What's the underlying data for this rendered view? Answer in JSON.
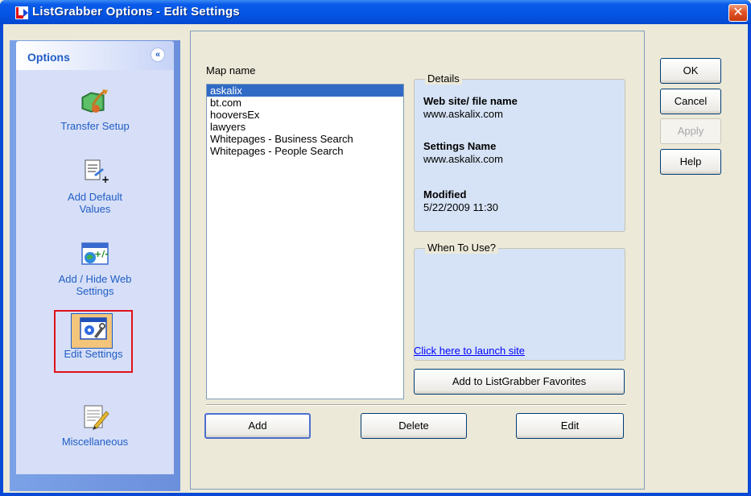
{
  "window": {
    "title": "ListGrabber Options - Edit Settings",
    "close_glyph": "✕"
  },
  "sidebar": {
    "header": "Options",
    "collapse_glyph": "«",
    "items": [
      {
        "label": "Transfer Setup",
        "icon": "transfer-setup-icon"
      },
      {
        "label": "Add Default Values",
        "icon": "add-default-values-icon"
      },
      {
        "label": "Add / Hide Web Settings",
        "icon": "add-hide-web-settings-icon"
      },
      {
        "label": "Edit Settings",
        "icon": "edit-settings-icon",
        "selected": true
      },
      {
        "label": "Miscellaneous",
        "icon": "miscellaneous-icon"
      }
    ]
  },
  "map": {
    "label": "Map name",
    "items": [
      "askalix",
      "bt.com",
      "hooversEx",
      "lawyers",
      "Whitepages - Business Search",
      "Whitepages - People Search"
    ],
    "selected_index": 0
  },
  "details": {
    "title": "Details",
    "site_label": "Web site/ file name",
    "site_value": "www.askalix.com",
    "settings_label": "Settings Name",
    "settings_value": "www.askalix.com",
    "modified_label": "Modified",
    "modified_value": "5/22/2009  11:30"
  },
  "when_to_use": {
    "title": "When To Use?"
  },
  "launch_link": "Click here to launch site",
  "favorites_button": "Add to ListGrabber Favorites",
  "bottom_buttons": {
    "add": "Add",
    "delete": "Delete",
    "edit": "Edit"
  },
  "right_buttons": {
    "ok": "OK",
    "cancel": "Cancel",
    "apply": "Apply",
    "help": "Help"
  },
  "colors": {
    "title_bar": "#0555E4",
    "selection": "#316AC5",
    "sidebar_text": "#215DC6",
    "highlight_frame": "#E0101A",
    "link": "#0000FF"
  }
}
